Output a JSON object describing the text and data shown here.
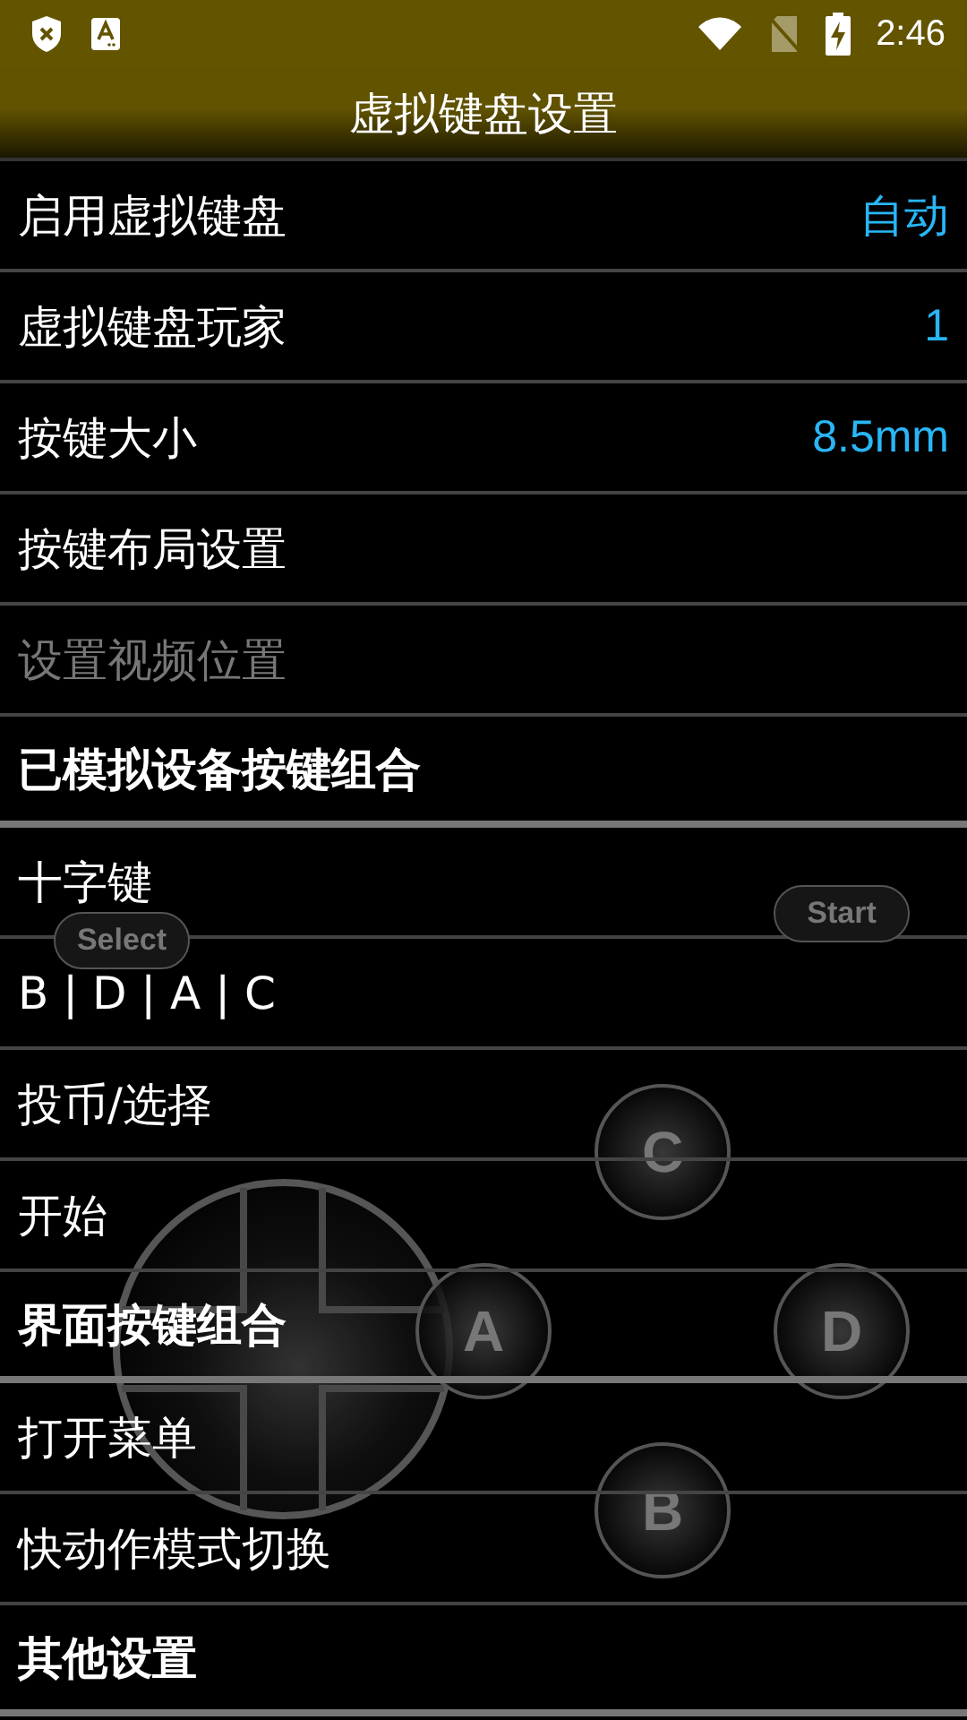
{
  "status_bar": {
    "time": "2:46"
  },
  "title": "虚拟键盘设置",
  "rows": [
    {
      "kind": "setting",
      "label": "启用虚拟键盘",
      "value": "自动",
      "disabled": false
    },
    {
      "kind": "setting",
      "label": "虚拟键盘玩家",
      "value": "1",
      "disabled": false
    },
    {
      "kind": "setting",
      "label": "按键大小",
      "value": "8.5mm",
      "disabled": false
    },
    {
      "kind": "setting",
      "label": "按键布局设置",
      "disabled": false
    },
    {
      "kind": "setting",
      "label": "设置视频位置",
      "disabled": true
    },
    {
      "kind": "header",
      "label": "已模拟设备按键组合"
    },
    {
      "kind": "setting",
      "label": "十字键",
      "disabled": false
    },
    {
      "kind": "setting",
      "label": "B | D | A | C",
      "disabled": false
    },
    {
      "kind": "setting",
      "label": "投币/选择",
      "disabled": false
    },
    {
      "kind": "setting",
      "label": "开始",
      "disabled": false
    },
    {
      "kind": "header",
      "label": "界面按键组合"
    },
    {
      "kind": "setting",
      "label": "打开菜单",
      "disabled": false
    },
    {
      "kind": "setting",
      "label": "快动作模式切换",
      "disabled": false
    },
    {
      "kind": "header",
      "label": "其他设置"
    }
  ],
  "gamepad": {
    "buttons": [
      {
        "kind": "pill",
        "label": "Select"
      },
      {
        "kind": "pill",
        "label": "Start"
      },
      {
        "kind": "round",
        "label": "C"
      },
      {
        "kind": "round",
        "label": "A"
      },
      {
        "kind": "round",
        "label": "D"
      },
      {
        "kind": "round",
        "label": "B"
      }
    ]
  }
}
